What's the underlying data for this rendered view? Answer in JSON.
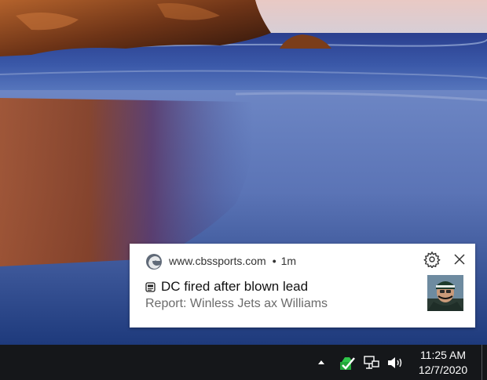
{
  "notification": {
    "source_icon": "edge-browser-icon",
    "source": "www.cbssports.com",
    "separator": "•",
    "time_ago": "1m",
    "title_icon": "newspaper-icon",
    "title": "DC fired after blown lead",
    "body": "Report: Winless Jets ax Williams",
    "settings_icon": "gear-icon",
    "close_icon": "close-icon"
  },
  "taskbar": {
    "tray_icons": [
      "chevron-up-icon",
      "green-check-app-icon",
      "network-icon",
      "volume-icon"
    ],
    "time": "11:25 AM",
    "date": "12/7/2020"
  },
  "colors": {
    "toast_bg": "#ffffff",
    "taskbar_bg": "#15171a",
    "toast_title": "#111111",
    "toast_body": "#6b6b6b"
  }
}
